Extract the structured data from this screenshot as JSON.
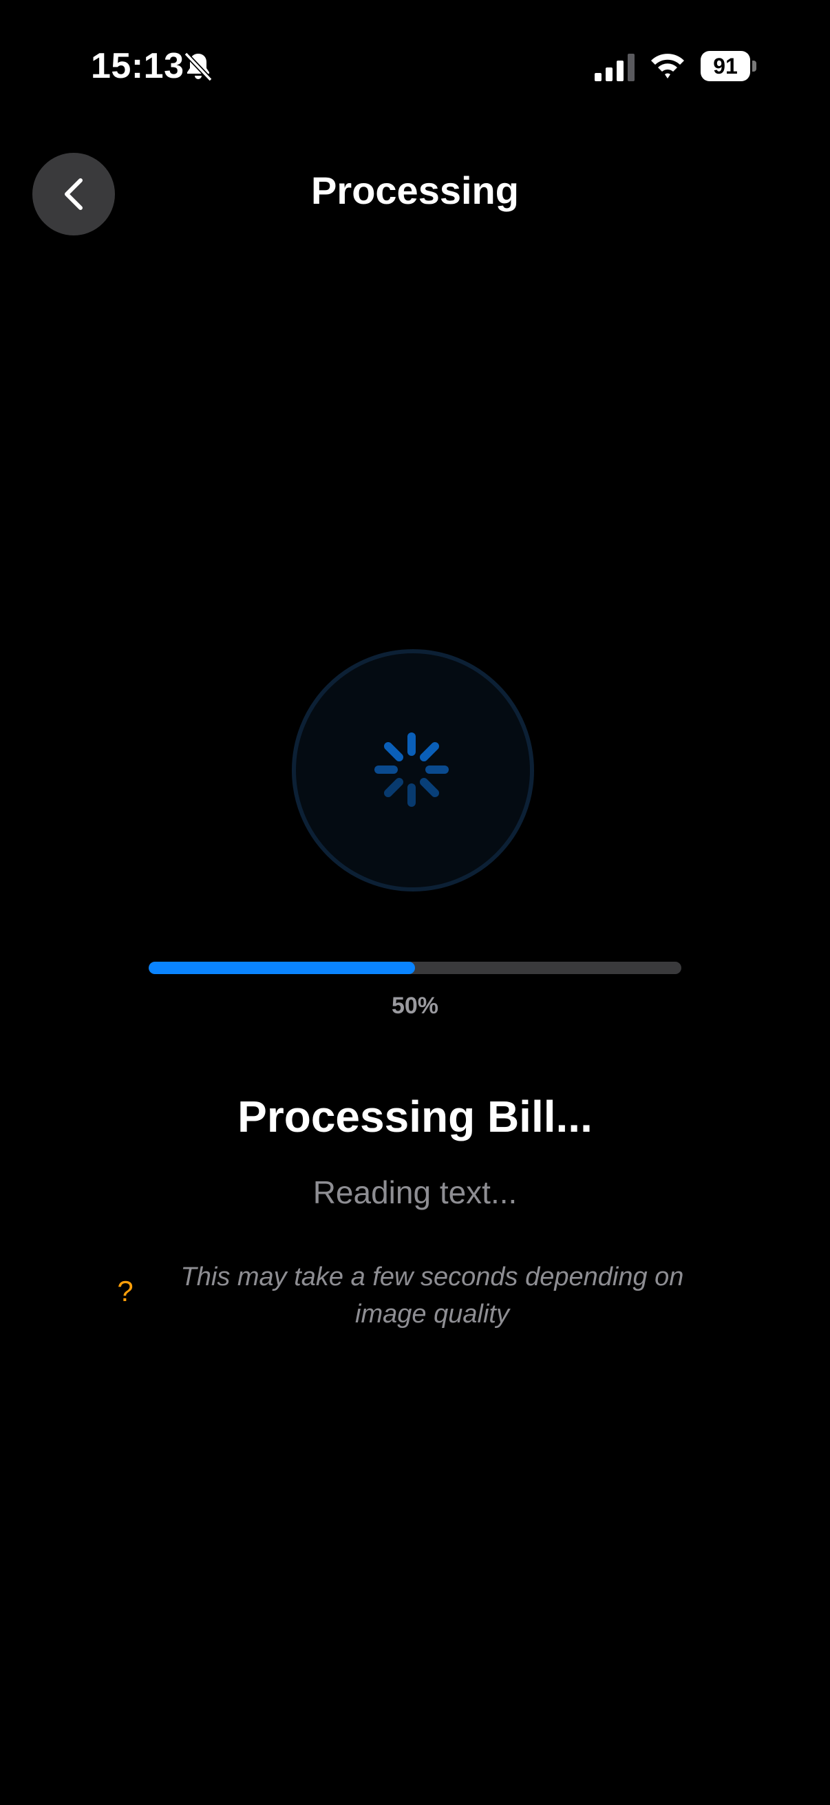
{
  "status_bar": {
    "time": "15:13",
    "battery": "91"
  },
  "header": {
    "title": "Processing"
  },
  "progress": {
    "value": 0.5,
    "label": "50%"
  },
  "content": {
    "title": "Processing Bill...",
    "subtitle": "Reading text...",
    "tip_icon": "?",
    "tip_text": "This may take a few seconds depending on image quality"
  },
  "colors": {
    "accent": "#0a84ff",
    "tip_icon": "#ff9f0a",
    "secondary_text": "#8e8e93"
  }
}
